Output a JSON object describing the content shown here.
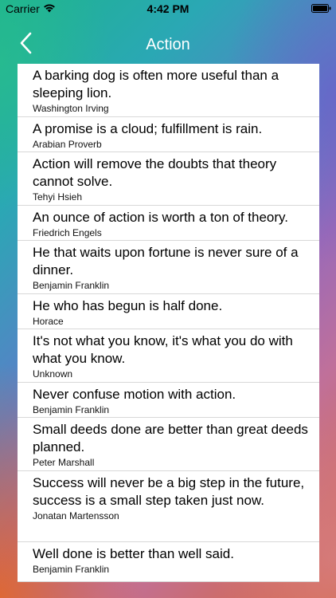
{
  "status_bar": {
    "carrier": "Carrier",
    "time": "4:42 PM",
    "wifi_icon": "wifi-icon",
    "battery_icon": "battery-icon"
  },
  "nav": {
    "title": "Action",
    "back_icon": "chevron-left-icon"
  },
  "quotes": [
    {
      "text": "A barking dog is often more useful than a sleeping lion.",
      "author": "Washington Irving"
    },
    {
      "text": "A promise is a cloud; fulfillment is rain.",
      "author": "Arabian Proverb"
    },
    {
      "text": "Action will remove the doubts that theory cannot solve.",
      "author": "Tehyi Hsieh"
    },
    {
      "text": "An ounce of action is worth a ton of theory.",
      "author": "Friedrich Engels"
    },
    {
      "text": "He that waits upon fortune is never sure of a dinner.",
      "author": "Benjamin Franklin"
    },
    {
      "text": "He who has begun is half done.",
      "author": "Horace"
    },
    {
      "text": "It's not what you know, it's what you do with what you know.",
      "author": "Unknown"
    },
    {
      "text": "Never confuse motion with action.",
      "author": "Benjamin Franklin"
    },
    {
      "text": "Small deeds done are better than great deeds planned.",
      "author": "Peter Marshall"
    },
    {
      "text": "Success will never be a big step in the future, success is a small step taken just now.",
      "author": "Jonatan Martensson"
    },
    {
      "text": "Well done is better than well said.",
      "author": "Benjamin Franklin"
    }
  ],
  "colors": {
    "nav_title": "#ffffff",
    "list_background": "#ffffff",
    "separator": "#d8d8d8"
  }
}
